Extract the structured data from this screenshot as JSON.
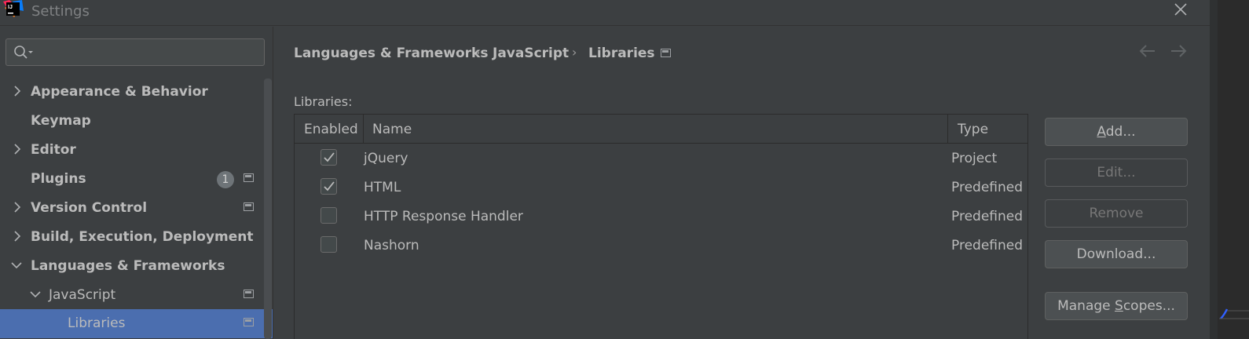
{
  "window": {
    "title": "Settings"
  },
  "sidebar": {
    "search": {
      "placeholder": ""
    },
    "items": [
      {
        "label": "Appearance & Behavior",
        "expandable": true,
        "expanded": false
      },
      {
        "label": "Keymap",
        "expandable": false
      },
      {
        "label": "Editor",
        "expandable": true,
        "expanded": false
      },
      {
        "label": "Plugins",
        "expandable": false,
        "badge": "1"
      },
      {
        "label": "Version Control",
        "expandable": true,
        "expanded": false
      },
      {
        "label": "Build, Execution, Deployment",
        "expandable": true,
        "expanded": false
      },
      {
        "label": "Languages & Frameworks",
        "expandable": true,
        "expanded": true
      },
      {
        "label": "JavaScript",
        "expandable": true,
        "expanded": true
      },
      {
        "label": "Libraries",
        "selected": true
      }
    ]
  },
  "breadcrumb": {
    "items": [
      "Languages & Frameworks",
      "JavaScript",
      "Libraries"
    ],
    "separator": "›"
  },
  "content": {
    "section_label": "Libraries:",
    "table": {
      "columns": [
        "Enabled",
        "Name",
        "Type"
      ],
      "rows": [
        {
          "enabled": true,
          "name": "jQuery",
          "type": "Project"
        },
        {
          "enabled": true,
          "name": "HTML",
          "type": "Predefined"
        },
        {
          "enabled": false,
          "name": "HTTP Response Handler",
          "type": "Predefined"
        },
        {
          "enabled": false,
          "name": "Nashorn",
          "type": "Predefined"
        }
      ]
    },
    "buttons": {
      "add": {
        "pre": "",
        "mnemonic": "A",
        "post": "dd..."
      },
      "edit": "Edit...",
      "remove": "Remove",
      "download": "Download...",
      "manage_scopes": {
        "pre": "Manage ",
        "mnemonic": "S",
        "post": "copes..."
      }
    }
  },
  "colors": {
    "background": "#3c3f41",
    "selection": "#4b6eaf",
    "text": "#bbbbbb"
  },
  "icons": {
    "app": "intellij-logo-icon",
    "close": "close-icon",
    "search": "search-icon",
    "back": "arrow-left-icon",
    "forward": "arrow-right-icon",
    "project_level": "project-level-icon",
    "checkbox": "checkmark-icon"
  }
}
